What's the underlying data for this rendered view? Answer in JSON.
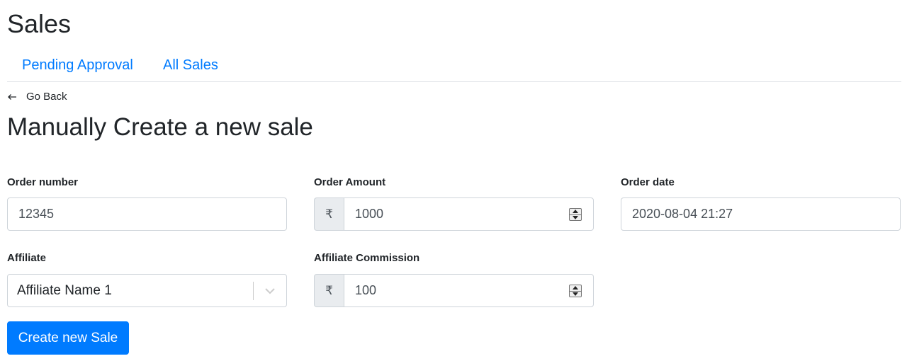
{
  "header": {
    "title": "Sales"
  },
  "tabs": [
    {
      "label": "Pending Approval"
    },
    {
      "label": "All Sales"
    }
  ],
  "back": {
    "label": "Go Back",
    "icon": "arrow-left-icon"
  },
  "form": {
    "title": "Manually Create a new sale",
    "order_number": {
      "label": "Order number",
      "value": "12345"
    },
    "order_amount": {
      "label": "Order Amount",
      "prefix": "₹",
      "value": "1000"
    },
    "order_date": {
      "label": "Order date",
      "value": "2020-08-04 21:27"
    },
    "affiliate": {
      "label": "Affiliate",
      "value": "Affiliate Name 1"
    },
    "affiliate_commission": {
      "label": "Affiliate Commission",
      "prefix": "₹",
      "value": "100"
    },
    "submit_label": "Create new Sale"
  },
  "colors": {
    "link": "#007bff",
    "primary": "#007bff",
    "addon_bg": "#e9ecef",
    "border": "#ced4da"
  }
}
